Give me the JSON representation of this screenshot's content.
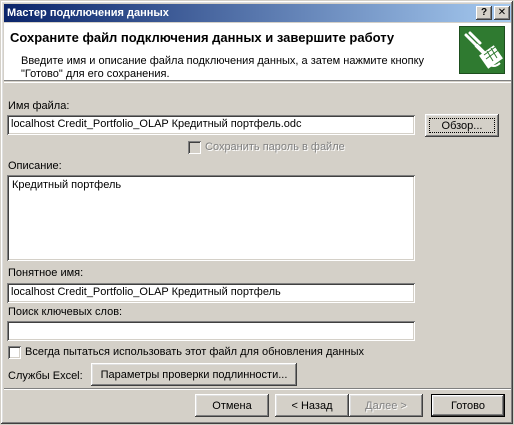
{
  "window": {
    "title": "Мастер подключения данных",
    "help_glyph": "?",
    "close_glyph": "✕"
  },
  "header": {
    "title": "Сохраните файл подключения данных и завершите работу",
    "description": "Введите имя и описание файла подключения данных, а затем нажмите кнопку \"Готово\" для его сохранения.",
    "icon": "data-connection-plug-icon"
  },
  "form": {
    "filename_label": "Имя файла:",
    "filename_value": "localhost Credit_Portfolio_OLAP Кредитный портфель.odc",
    "browse_button": "Обзор...",
    "save_password_label": "Сохранить пароль в файле",
    "description_label": "Описание:",
    "description_value": "Кредитный портфель",
    "friendly_name_label": "Понятное имя:",
    "friendly_name_value": "localhost Credit_Portfolio_OLAP Кредитный портфель",
    "keywords_label": "Поиск ключевых слов:",
    "keywords_value": "",
    "always_use_label": "Всегда пытаться использовать этот файл для обновления данных",
    "excel_services_label": "Службы Excel:",
    "auth_button": "Параметры проверки подлинности..."
  },
  "footer": {
    "cancel": "Отмена",
    "back": "< Назад",
    "next": "Далее >",
    "finish": "Готово"
  },
  "colors": {
    "titlebar_start": "#0a246a",
    "titlebar_end": "#a6caf0",
    "face": "#d4d0c8",
    "icon_green": "#2f7a30"
  }
}
